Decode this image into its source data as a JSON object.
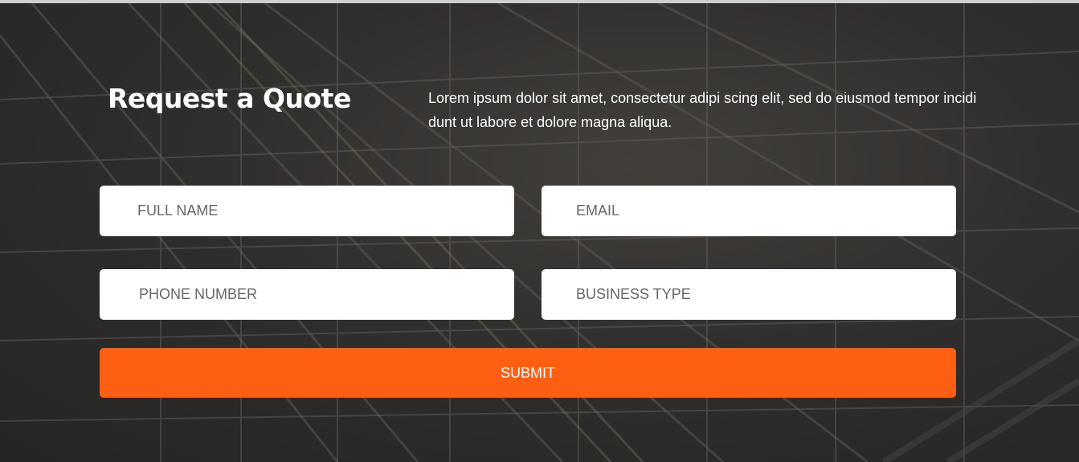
{
  "quote_section": {
    "title": "Request a Quote",
    "intro": "Lorem ipsum dolor sit amet, consectetur adipi scing elit, sed do eiusmod tempor incidi dunt ut labore et dolore magna aliqua."
  },
  "form": {
    "full_name": {
      "placeholder": "FULL NAME",
      "value": ""
    },
    "email": {
      "placeholder": "EMAIL",
      "value": ""
    },
    "phone": {
      "placeholder": "PHONE NUMBER",
      "value": ""
    },
    "business_type": {
      "placeholder": "BUSINESS TYPE",
      "value": ""
    },
    "submit_label": "SUBMIT"
  },
  "colors": {
    "accent": "#ff5f13",
    "text_on_dark": "#ffffff",
    "field_background": "#ffffff"
  }
}
